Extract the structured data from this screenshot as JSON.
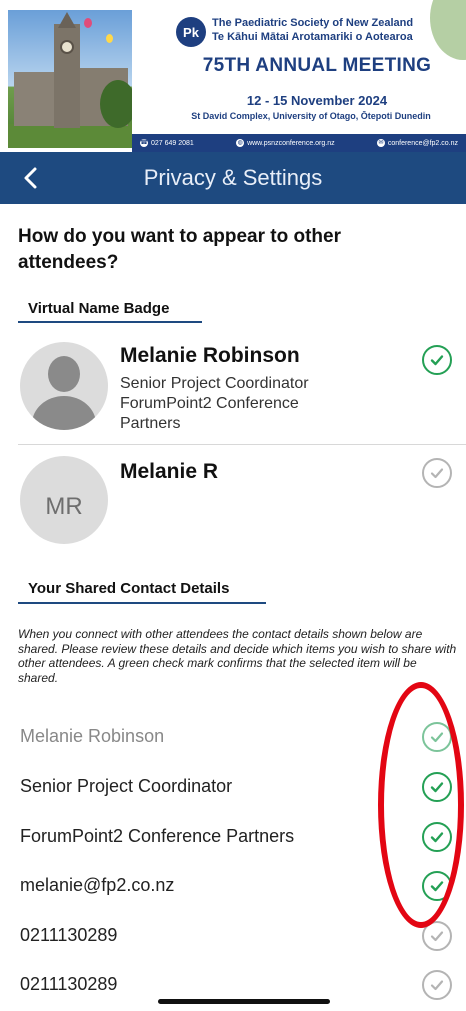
{
  "banner": {
    "society_line1": "The Paediatric Society of New Zealand",
    "society_line2": "Te Kāhui Mātai Arotamariki o Aotearoa",
    "logo_text": "Pk",
    "meeting_title": "75TH ANNUAL MEETING",
    "dates": "12 - 15 November 2024",
    "venue": "St David Complex, University of Otago, Ōtepoti Dunedin",
    "phone": "027 649 2081",
    "website": "www.psnzconference.org.nz",
    "email": "conference@fp2.co.nz",
    "colors": {
      "navy": "#1e3f80",
      "pink": "#e46a85",
      "sage": "#b5cfa4"
    }
  },
  "navbar": {
    "back_icon": "‹",
    "title": "Privacy & Settings",
    "background": "#1e4a80"
  },
  "content": {
    "question": "How do you want to appear to other attendees?",
    "badge_section": {
      "title": "Virtual Name Badge",
      "options": [
        {
          "name": "Melanie Robinson",
          "lines": [
            "Senior Project Coordinator",
            "ForumPoint2 Conference",
            "Partners"
          ],
          "avatar": "person-silhouette",
          "selected": true
        },
        {
          "name": "Melanie R",
          "initials": "MR",
          "selected": false
        }
      ]
    },
    "contact_section": {
      "title": "Your Shared Contact Details",
      "description": "When you connect with other attendees the contact details shown below are shared. Please review these details and decide which items you wish to share with other attendees. A green check mark confirms that the selected item will be shared.",
      "items": [
        {
          "text": "Melanie Robinson",
          "state": "locked"
        },
        {
          "text": "Senior Project Coordinator",
          "state": "on"
        },
        {
          "text": "ForumPoint2 Conference Partners",
          "state": "on"
        },
        {
          "text": "melanie@fp2.co.nz",
          "state": "on"
        },
        {
          "text": "0211130289",
          "state": "off"
        },
        {
          "text": "0211130289",
          "state": "off"
        }
      ]
    }
  },
  "status_colors": {
    "on": "#24a055",
    "off": "#b4b4b4",
    "annotation": "#e30613"
  }
}
